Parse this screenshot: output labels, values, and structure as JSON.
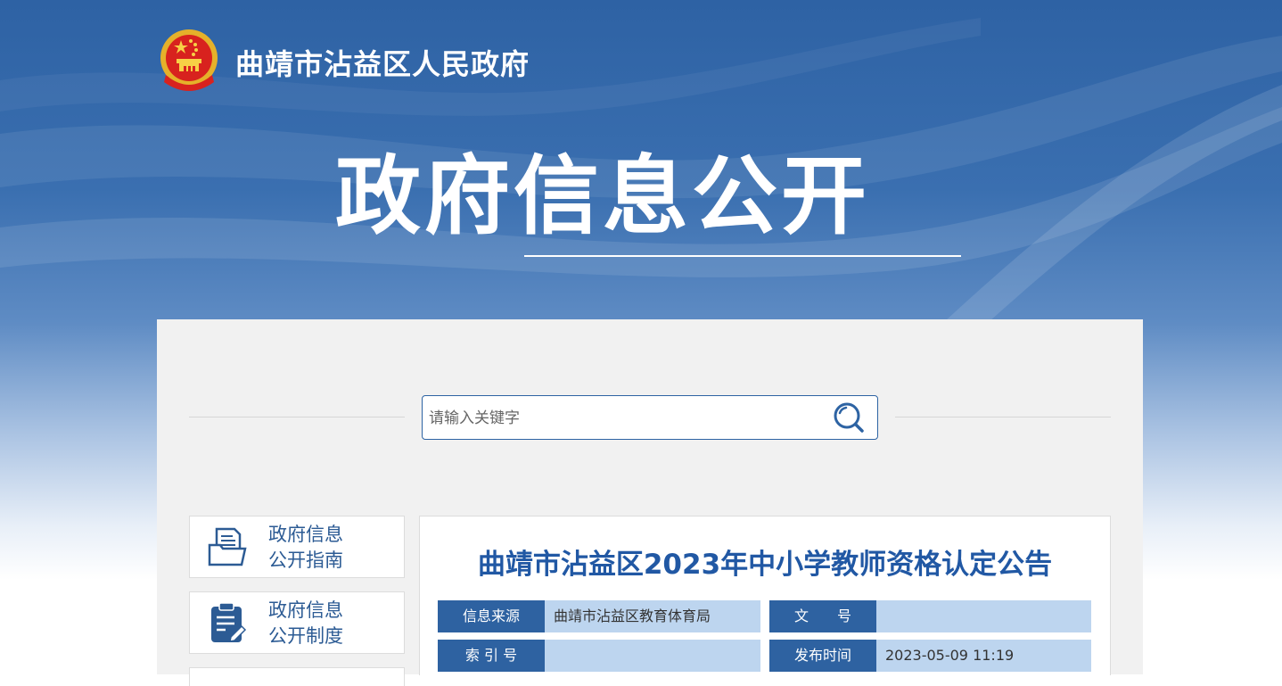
{
  "header": {
    "site_name": "曲靖市沾益区人民政府",
    "main_title": "政府信息公开"
  },
  "search": {
    "placeholder": "请输入关键字",
    "value": ""
  },
  "sidebar": {
    "items": [
      {
        "label_line1": "政府信息",
        "label_line2": "公开指南",
        "icon": "document-folder-icon"
      },
      {
        "label_line1": "政府信息",
        "label_line2": "公开制度",
        "icon": "clipboard-pen-icon"
      }
    ]
  },
  "article": {
    "title": "曲靖市沾益区2023年中小学教师资格认定公告",
    "meta": {
      "source_label": "信息来源",
      "source_value": "曲靖市沾益区教育体育局",
      "doc_no_label": "文　　号",
      "doc_no_value": "",
      "index_label": "索 引 号",
      "index_value": "",
      "publish_label": "发布时间",
      "publish_value": "2023-05-09 11:19"
    }
  },
  "colors": {
    "banner_blue": "#2e62a4",
    "accent_blue": "#2e62a1",
    "meta_value_bg": "#bdd5ef",
    "title_blue": "#2158a4"
  }
}
